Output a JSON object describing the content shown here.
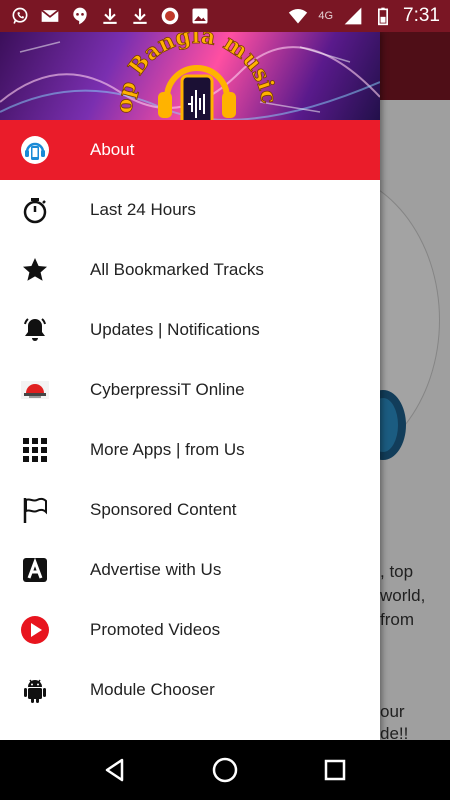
{
  "status_bar": {
    "time": "7:31",
    "network": "4G",
    "notification_icons": [
      "whatsapp-icon",
      "gmail-icon",
      "hangouts-icon",
      "download-icon",
      "download-icon",
      "app-icon",
      "image-icon"
    ],
    "status_icons": [
      "wifi-icon",
      "signal-icon",
      "battery-icon"
    ]
  },
  "drawer": {
    "header": {
      "logo_text": "Top Bangla musical"
    },
    "items": [
      {
        "label": "About",
        "icon": "headphone-phone-icon",
        "active": true
      },
      {
        "label": "Last 24 Hours",
        "icon": "stopwatch-icon",
        "active": false
      },
      {
        "label": "All Bookmarked Tracks",
        "icon": "star-icon",
        "active": false
      },
      {
        "label": "Updates | Notifications",
        "icon": "bell-icon",
        "active": false
      },
      {
        "label": "CyberpressiT Online",
        "icon": "cyberpressit-icon",
        "active": false
      },
      {
        "label": "More Apps | from Us",
        "icon": "grid-icon",
        "active": false
      },
      {
        "label": "Sponsored Content",
        "icon": "flag-icon",
        "active": false
      },
      {
        "label": "Advertise with Us",
        "icon": "letter-a-icon",
        "active": false
      },
      {
        "label": "Promoted Videos",
        "icon": "play-icon",
        "active": false
      },
      {
        "label": "Module Chooser",
        "icon": "android-icon",
        "active": false
      }
    ]
  },
  "background": {
    "text_lines": [
      ", top",
      "world,",
      "from",
      "our",
      "de!!"
    ]
  },
  "colors": {
    "accent": "#ea1c2a",
    "app_bar": "#7a1624"
  },
  "nav_bar": {
    "buttons": [
      "back-icon",
      "home-icon",
      "recents-icon"
    ]
  }
}
